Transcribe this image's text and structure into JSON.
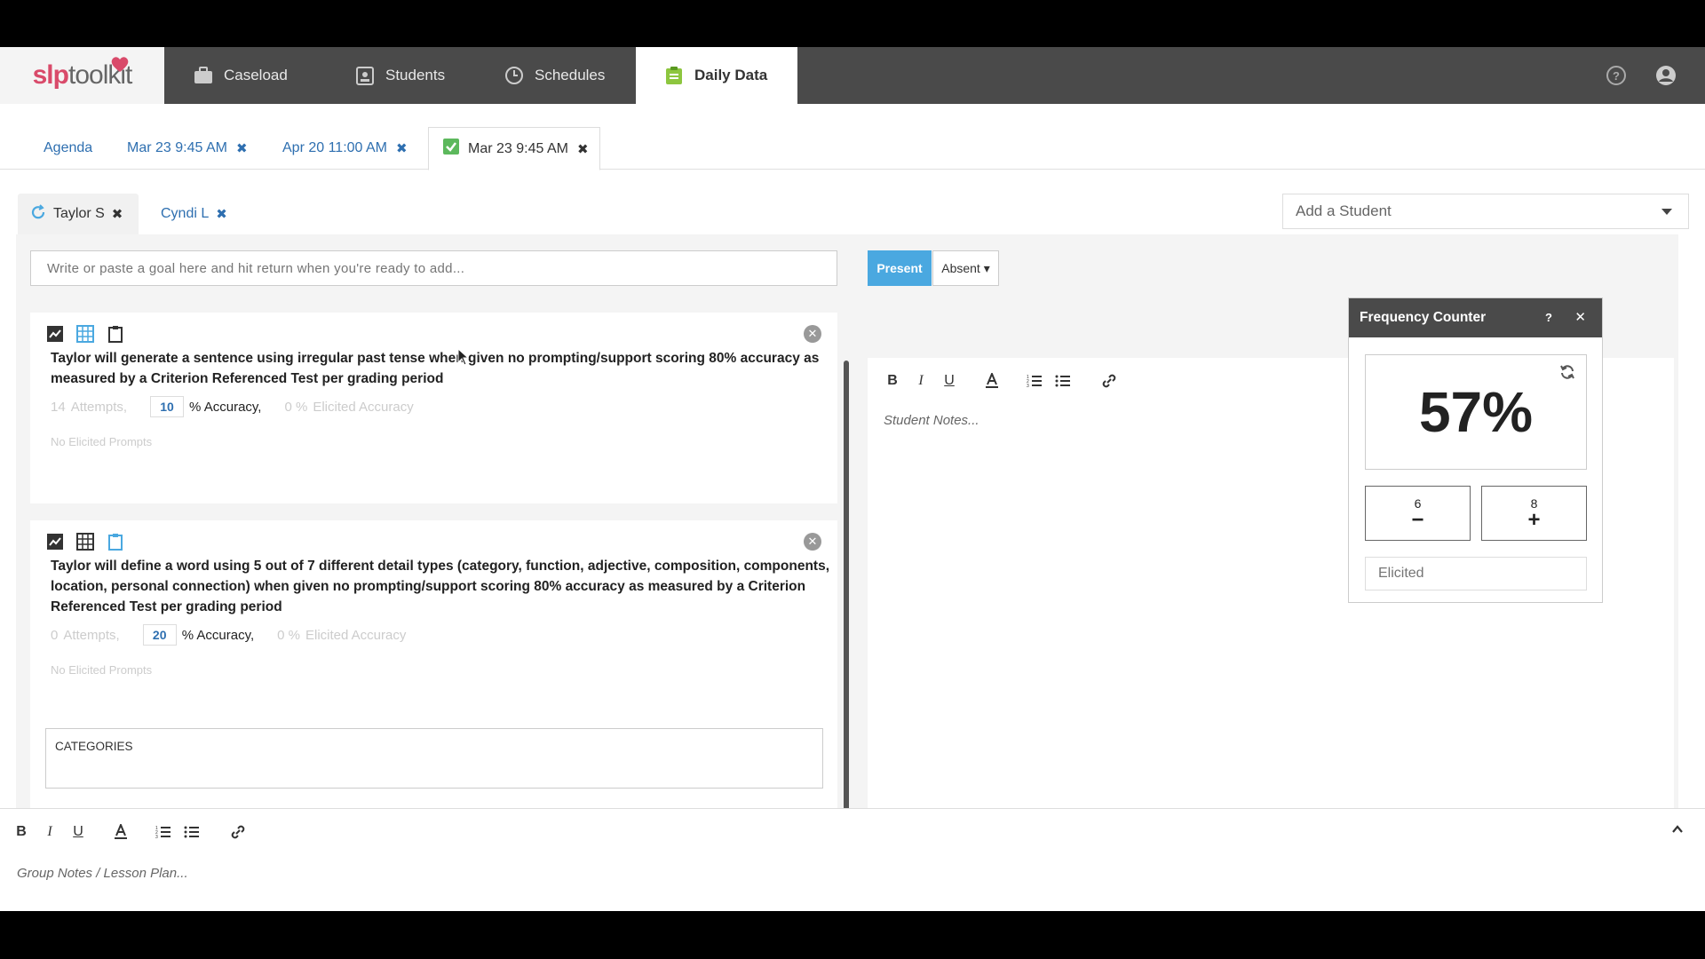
{
  "nav": {
    "logo": {
      "slp": "slp",
      "toolkit": "toolkit"
    },
    "items": [
      {
        "label": "Caseload",
        "icon": "briefcase-icon"
      },
      {
        "label": "Students",
        "icon": "id-card-icon"
      },
      {
        "label": "Schedules",
        "icon": "clock-icon"
      },
      {
        "label": "Daily Data",
        "icon": "clipboard-icon",
        "active": true
      }
    ]
  },
  "session_tabs": [
    {
      "label": "Agenda"
    },
    {
      "label": "Mar 23 9:45 AM"
    },
    {
      "label": "Apr 20 11:00 AM"
    },
    {
      "label": "Mar 23 9:45 AM",
      "active": true
    }
  ],
  "students": {
    "tabs": [
      {
        "label": "Taylor S",
        "active": true
      },
      {
        "label": "Cyndi L"
      }
    ],
    "add_student": "Add a Student"
  },
  "goal_input": {
    "placeholder": "Write or paste a goal here and hit return when you're ready to add..."
  },
  "attendance": {
    "present": "Present",
    "absent": "Absent"
  },
  "goals": [
    {
      "text": "Taylor will generate a sentence using irregular past tense when given no prompting/support scoring 80% accuracy as measured by a Criterion Referenced Test per grading period",
      "attempts_num": "14",
      "attempts_label": "Attempts,",
      "accuracy": "10",
      "accuracy_label": "% Accuracy,",
      "elicited_pct": "0 %",
      "elicited_label": "Elicited Accuracy",
      "no_prompts": "No Elicited Prompts"
    },
    {
      "text": "Taylor will define a word using 5 out of 7 different detail types (category, function, adjective, composition, components, location, personal connection) when given no prompting/support scoring 80% accuracy as measured by a Criterion Referenced Test per grading period",
      "attempts_num": "0",
      "attempts_label": "Attempts,",
      "accuracy": "20",
      "accuracy_label": "% Accuracy,",
      "elicited_pct": "0 %",
      "elicited_label": "Elicited Accuracy",
      "no_prompts": "No Elicited Prompts",
      "categories": "CATEGORIES"
    }
  ],
  "notes": {
    "student_placeholder": "Student Notes...",
    "group_placeholder": "Group Notes / Lesson Plan..."
  },
  "freq_counter": {
    "title": "Frequency Counter",
    "help": "?",
    "percent": "57%",
    "minus_count": "6",
    "plus_count": "8",
    "elicited_placeholder": "Elicited"
  },
  "colors": {
    "nav_bg": "#4a4a4a",
    "link": "#2e6fb0",
    "present": "#4aa8e0",
    "brand": "#d94a6a"
  }
}
